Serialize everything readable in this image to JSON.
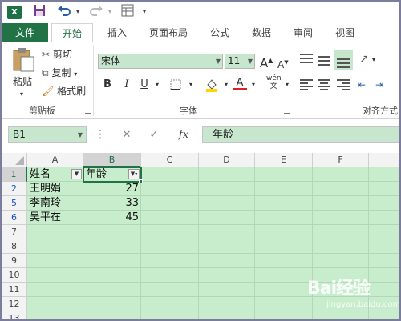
{
  "qat": {
    "app_icon": "X",
    "save_icon": "save-icon",
    "undo_icon": "undo-icon",
    "redo_icon": "redo-icon",
    "form_icon": "form-icon",
    "customize_icon": "customize-icon"
  },
  "tabs": [
    {
      "label": "文件"
    },
    {
      "label": "开始"
    },
    {
      "label": "插入"
    },
    {
      "label": "页面布局"
    },
    {
      "label": "公式"
    },
    {
      "label": "数据"
    },
    {
      "label": "审阅"
    },
    {
      "label": "视图"
    }
  ],
  "clipboard": {
    "paste_label": "粘贴",
    "cut_label": "剪切",
    "copy_label": "复制",
    "format_painter_label": "格式刷",
    "group_label": "剪贴板"
  },
  "font": {
    "font_name": "宋体",
    "font_size": "11",
    "grow_label": "A",
    "shrink_label": "A",
    "bold_label": "B",
    "italic_label": "I",
    "underline_label": "U",
    "font_color_label": "A",
    "phonetic_label": "wén",
    "phonetic_sub": "文",
    "group_label": "字体"
  },
  "alignment": {
    "group_label": "对齐方式"
  },
  "formula_bar": {
    "name_box": "B1",
    "cancel": "✕",
    "enter": "✓",
    "fx": "fx",
    "content": "年龄"
  },
  "grid": {
    "columns": [
      "A",
      "B",
      "C",
      "D",
      "E",
      "F"
    ],
    "rows": [
      "1",
      "2",
      "5",
      "6",
      "7",
      "8",
      "9",
      "10",
      "11",
      "12",
      "13"
    ],
    "cells": {
      "A1": "姓名",
      "B1": "年龄",
      "A2": "王明娟",
      "B2": "27",
      "A5": "李南玲",
      "B5": "33",
      "A6": "吴平在",
      "B6": "45"
    }
  },
  "watermark": {
    "text": "Bai经验",
    "sub": "jingyan.baidu.com"
  },
  "colors": {
    "excel_green": "#217346",
    "sheet_bg": "#c7edcc",
    "filtered_row": "#1f4fc1"
  }
}
